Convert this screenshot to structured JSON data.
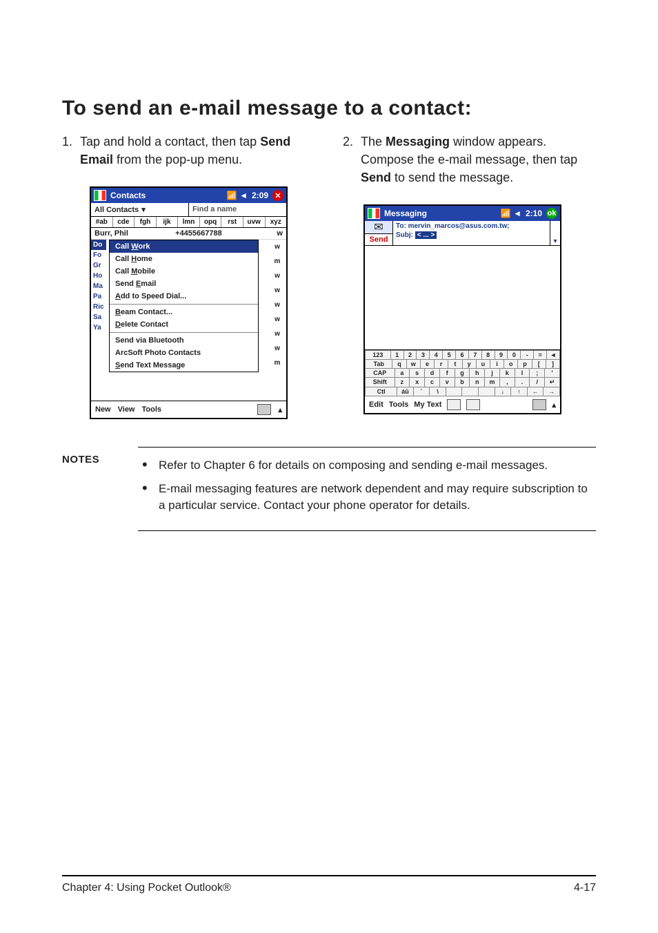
{
  "heading": "To send an e-mail message to a contact:",
  "steps": {
    "left_num": "1.",
    "left_body_pre": "Tap and hold a contact, then tap ",
    "left_body_bold": "Send Email",
    "left_body_post": " from the pop-up menu.",
    "right_num": "2.",
    "right_body_pre": "The ",
    "right_body_bold1": "Messaging",
    "right_body_mid": " window appears. Compose the e-mail message, then tap ",
    "right_body_bold2": "Send",
    "right_body_post": " to send the message."
  },
  "contacts_screen": {
    "title": "Contacts",
    "time": "2:09",
    "all_contacts": "All Contacts",
    "find_label": "Find a name",
    "alpha": [
      "#ab",
      "cde",
      "fgh",
      "ijk",
      "lmn",
      "opq",
      "rst",
      "uvw",
      "xyz"
    ],
    "top_row_name": "Burr, Phil",
    "top_row_num": "+4455667788",
    "top_row_mark": "w",
    "left_labels": [
      "Do",
      "Fo",
      "Gr",
      "Ho",
      "Ma",
      "Pa",
      "Ric",
      "Sa",
      "Ya"
    ],
    "right_marks": [
      "w",
      "m",
      "w",
      "w",
      "w",
      "w",
      "w",
      "w",
      "m"
    ],
    "popup": [
      "Call Work",
      "Call Home",
      "Call Mobile",
      "Send Email",
      "Add to Speed Dial...",
      "Beam Contact...",
      "Delete Contact",
      "Send via Bluetooth",
      "ArcSoft Photo Contacts",
      "Send Text Message"
    ],
    "bottom": [
      "New",
      "View",
      "Tools"
    ]
  },
  "messaging_screen": {
    "title": "Messaging",
    "time": "2:10",
    "send": "Send",
    "to": "To: mervin_marcos@asus.com.tw;",
    "subj_label": "Subj:",
    "subj_value": "< ... >",
    "kb_rows": [
      [
        "123",
        "1",
        "2",
        "3",
        "4",
        "5",
        "6",
        "7",
        "8",
        "9",
        "0",
        "-",
        "=",
        "◄"
      ],
      [
        "Tab",
        "q",
        "w",
        "e",
        "r",
        "t",
        "y",
        "u",
        "i",
        "o",
        "p",
        "[",
        "]"
      ],
      [
        "CAP",
        "a",
        "s",
        "d",
        "f",
        "g",
        "h",
        "j",
        "k",
        "l",
        ";",
        "'"
      ],
      [
        "Shift",
        "z",
        "x",
        "c",
        "v",
        "b",
        "n",
        "m",
        ",",
        ".",
        "/",
        "↵"
      ],
      [
        "Ctl",
        "áū",
        "`",
        "\\",
        " ",
        " ",
        " ",
        "↓",
        "↑",
        "←",
        "→"
      ]
    ],
    "bottom": [
      "Edit",
      "Tools",
      "My Text"
    ]
  },
  "notes": {
    "label": "NOTES",
    "bullets": [
      "Refer to Chapter 6 for details on composing and sending e-mail messages.",
      "E-mail messaging features are network dependent and may require subscription to a particular service. Contact your phone operator for details."
    ]
  },
  "footer": {
    "left": "Chapter 4: Using Pocket Outlook®",
    "right": "4-17"
  }
}
